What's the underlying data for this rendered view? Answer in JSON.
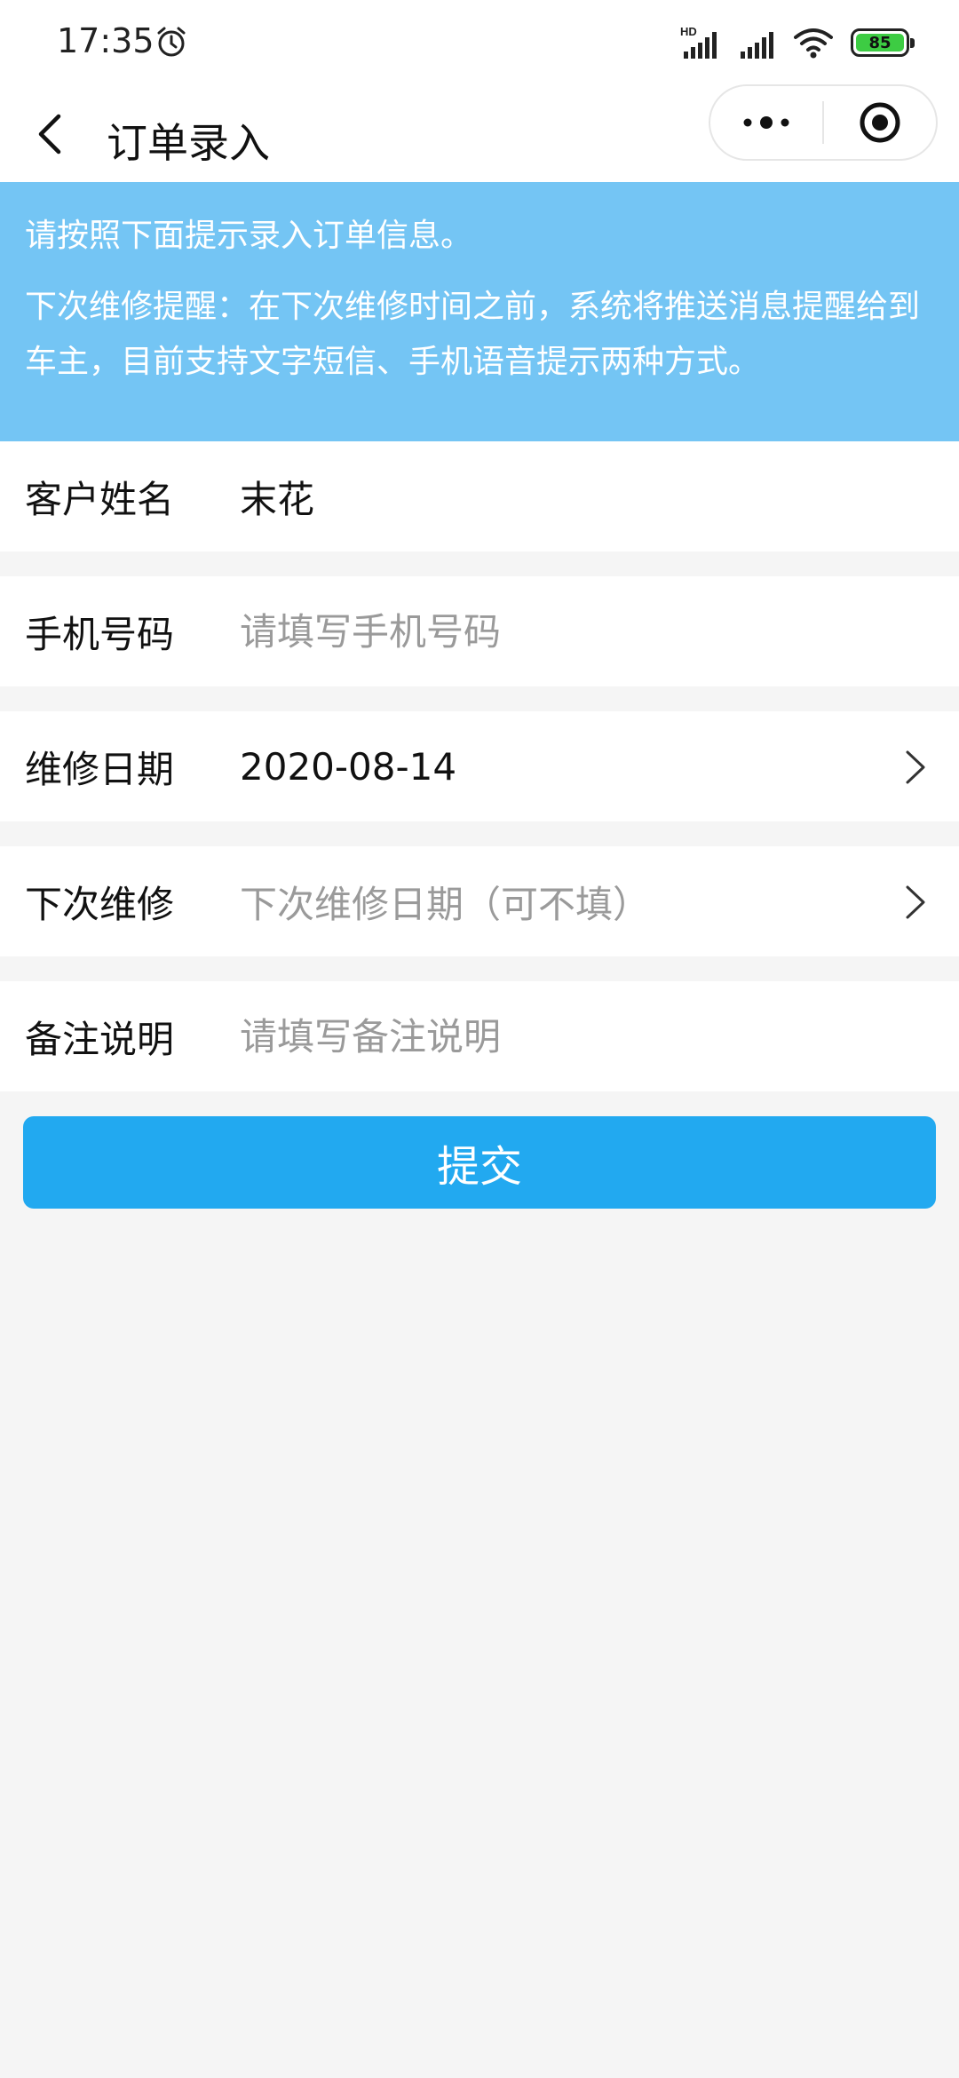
{
  "status_bar": {
    "time": "17:35",
    "battery": "85",
    "network_label": "HD"
  },
  "nav": {
    "title": "订单录入"
  },
  "notice": {
    "line1": "请按照下面提示录入订单信息。",
    "line2": "下次维修提醒：在下次维修时间之前，系统将推送消息提醒给到车主，目前支持文字短信、手机语音提示两种方式。"
  },
  "form": {
    "customer_name": {
      "label": "客户姓名",
      "value": "末花"
    },
    "phone": {
      "label": "手机号码",
      "placeholder": "请填写手机号码"
    },
    "repair_date": {
      "label": "维修日期",
      "value": "2020-08-14"
    },
    "next_repair": {
      "label": "下次维修",
      "placeholder": "下次维修日期（可不填）"
    },
    "remark": {
      "label": "备注说明",
      "placeholder": "请填写备注说明"
    }
  },
  "submit": {
    "label": "提交"
  },
  "colors": {
    "notice_bg": "#74c5f4",
    "button_bg": "#22a9f0",
    "battery_fill": "#3dcc43"
  }
}
